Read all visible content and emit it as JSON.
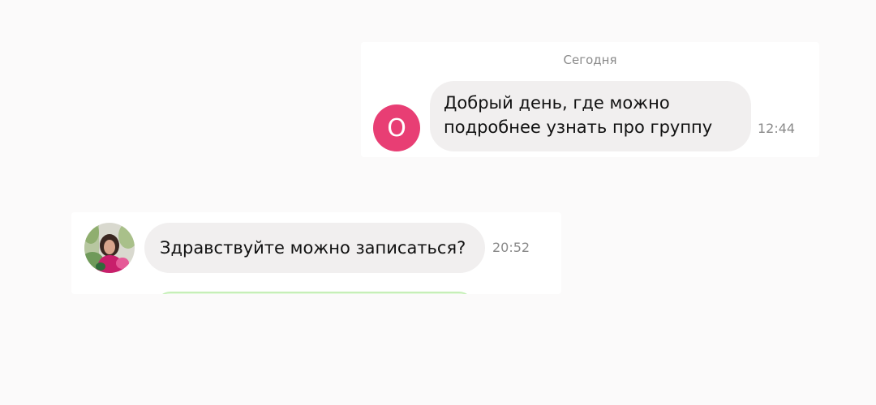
{
  "date_divider": "Сегодня",
  "messages": [
    {
      "avatar_letter": "О",
      "avatar_color": "#e83e74",
      "lines": [
        "Добрый день, где можно",
        "подробнее узнать про группу"
      ],
      "time": "12:44"
    },
    {
      "avatar_icon": "user-photo-avatar",
      "text": "Здравствуйте можно записаться?",
      "time": "20:52"
    }
  ],
  "colors": {
    "background": "#fbfafa",
    "card": "#ffffff",
    "bubble": "#f1efef",
    "next_bubble": "#e6f8df"
  }
}
